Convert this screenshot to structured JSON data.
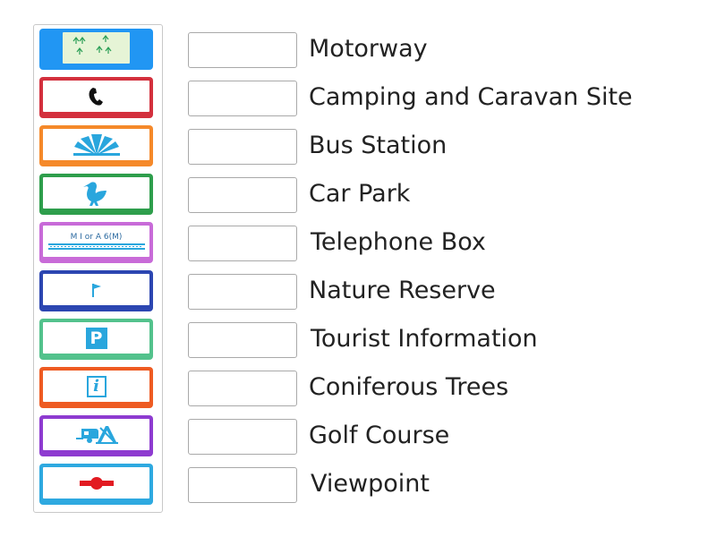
{
  "tiles": [
    {
      "icon": "coniferous-trees-icon",
      "color": "#2196f3",
      "inner_bg": "#e6f4d6"
    },
    {
      "icon": "telephone-icon",
      "color": "#d3303d"
    },
    {
      "icon": "viewpoint-icon",
      "color": "#f5892a"
    },
    {
      "icon": "nature-reserve-bird-icon",
      "color": "#2e9e4c"
    },
    {
      "icon": "motorway-icon",
      "color": "#c86bd8",
      "text": "M I or A 6(M)"
    },
    {
      "icon": "golf-flag-icon",
      "color": "#2c46b1"
    },
    {
      "icon": "car-park-icon",
      "color": "#53c28c",
      "text": "P"
    },
    {
      "icon": "tourist-information-icon",
      "color": "#ee5b22",
      "text": "i"
    },
    {
      "icon": "camping-caravan-icon",
      "color": "#8e3bd0"
    },
    {
      "icon": "bus-station-icon",
      "color": "#2ea9e0"
    }
  ],
  "labels": [
    "Motorway",
    "Camping and Caravan Site",
    "Bus Station",
    "Car Park",
    "Telephone Box",
    "Nature Reserve",
    "Tourist Information",
    "Coniferous Trees",
    "Golf Course",
    "Viewpoint"
  ],
  "symbol_color": "#29a6dd",
  "bus_symbol_color": "#e21b22"
}
